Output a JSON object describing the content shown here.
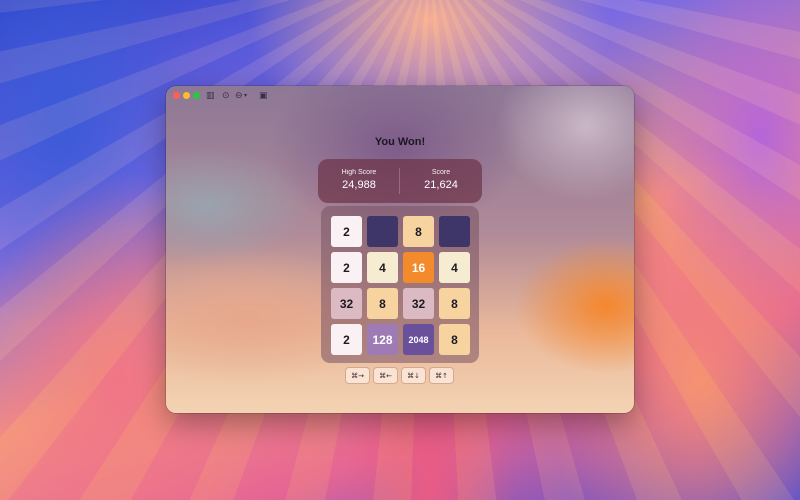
{
  "window": {
    "traffic_lights": {
      "close": "#ff5f57",
      "minimize": "#febc2e",
      "zoom": "#28c840"
    },
    "toolbar_icons": [
      "sidebar-icon",
      "record-icon",
      "minus-circle-icon",
      "chevron-down-icon",
      "save-icon"
    ]
  },
  "game": {
    "status": "You Won!",
    "high_score_label": "High Score",
    "high_score": "24,988",
    "score_label": "Score",
    "score": "21,624",
    "board": [
      [
        "2",
        "",
        "8",
        ""
      ],
      [
        "2",
        "4",
        "16",
        "4"
      ],
      [
        "32",
        "8",
        "32",
        "8"
      ],
      [
        "2",
        "128",
        "2048",
        "8"
      ]
    ],
    "tile_colors": {
      "empty": "#3e3568",
      "2": "#faf1f4",
      "4": "#f6ecd2",
      "8": "#f6d39f",
      "16": "#f38b2c",
      "32": "#dcbac4",
      "128": "#9f7bb5",
      "2048": "#6a4f9a"
    },
    "controls": [
      {
        "label": "⌘→",
        "action": "move-right"
      },
      {
        "label": "⌘←",
        "action": "move-left"
      },
      {
        "label": "⌘↓",
        "action": "move-down"
      },
      {
        "label": "⌘↑",
        "action": "move-up"
      }
    ]
  }
}
